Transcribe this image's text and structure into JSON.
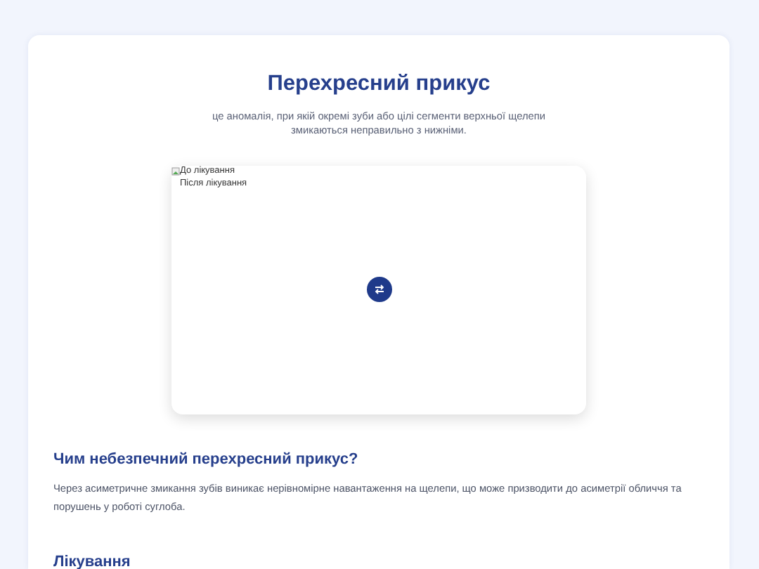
{
  "title": "Перехресний прикус",
  "subtitle": "це аномалія, при якій окремі зуби або цілі сегменти верхньої щелепи змикаються неправильно з нижніми.",
  "comparison": {
    "before_alt": "До лікування",
    "after_alt": "Після лікування"
  },
  "sections": [
    {
      "heading": "Чим небезпечний перехресний прикус?",
      "text": "Через асиметричне змикання зубів виникає нерівномірне навантаження на щелепи, що може призводити до асиметрії обличчя та порушень у роботі суглоба."
    },
    {
      "heading": "Лікування"
    }
  ]
}
